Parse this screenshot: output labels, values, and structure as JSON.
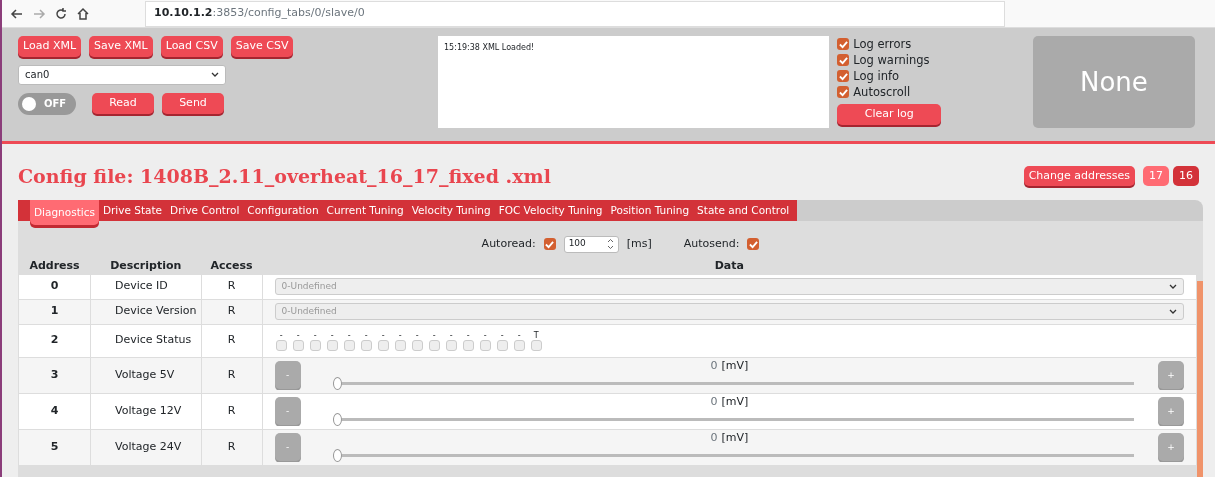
{
  "browser": {
    "url_host": "10.10.1.2",
    "url_path": ":3853/config_tabs/0/slave/0"
  },
  "toolbar": {
    "file_buttons": [
      "Load XML",
      "Save XML",
      "Load CSV",
      "Save CSV"
    ],
    "interface": {
      "value": "can0"
    },
    "connection_toggle": {
      "label": "OFF",
      "on": false
    },
    "action_buttons": [
      "Read",
      "Send"
    ],
    "log_text": "15:19:38 XML Loaded!",
    "log_options": [
      {
        "label": "Log errors",
        "checked": true
      },
      {
        "label": "Log warnings",
        "checked": true
      },
      {
        "label": "Log info",
        "checked": true
      },
      {
        "label": "Autoscroll",
        "checked": true
      }
    ],
    "clear_log": "Clear log",
    "status": "None"
  },
  "config_title": "Config file: 1408B_2.11_overheat_16_17_fixed .xml",
  "change_addresses": "Change addresses",
  "addresses": [
    {
      "label": "17",
      "selected": false
    },
    {
      "label": "16",
      "selected": true
    }
  ],
  "tabs": [
    {
      "label": "Diagnostics",
      "selected": true
    },
    {
      "label": "Drive State",
      "selected": false
    },
    {
      "label": "Drive Control",
      "selected": false
    },
    {
      "label": "Configuration",
      "selected": false
    },
    {
      "label": "Current Tuning",
      "selected": false
    },
    {
      "label": "Velocity Tuning",
      "selected": false
    },
    {
      "label": "FOC Velocity Tuning",
      "selected": false
    },
    {
      "label": "Position Tuning",
      "selected": false
    },
    {
      "label": "State and Control",
      "selected": false
    }
  ],
  "autoread": {
    "label": "Autoread:",
    "checked": true,
    "interval": "100",
    "unit": "[ms]"
  },
  "autosend": {
    "label": "Autosend:",
    "checked": true
  },
  "table": {
    "columns": [
      "Address",
      "Description",
      "Access",
      "Data"
    ],
    "rows": [
      {
        "address": "0",
        "description": "Device ID",
        "access": "R",
        "kind": "select",
        "value": "0-Undefined"
      },
      {
        "address": "1",
        "description": "Device Version",
        "access": "R",
        "kind": "select",
        "value": "0-Undefined"
      },
      {
        "address": "2",
        "description": "Device Status",
        "access": "R",
        "kind": "bits",
        "bits": [
          {
            "label": "-",
            "checked": false
          },
          {
            "label": "-",
            "checked": false
          },
          {
            "label": "-",
            "checked": false
          },
          {
            "label": "-",
            "checked": false
          },
          {
            "label": "-",
            "checked": false
          },
          {
            "label": "-",
            "checked": false
          },
          {
            "label": "-",
            "checked": false
          },
          {
            "label": "-",
            "checked": false
          },
          {
            "label": "-",
            "checked": false
          },
          {
            "label": "-",
            "checked": false
          },
          {
            "label": "-",
            "checked": false
          },
          {
            "label": "-",
            "checked": false
          },
          {
            "label": "-",
            "checked": false
          },
          {
            "label": "-",
            "checked": false
          },
          {
            "label": "-",
            "checked": false
          },
          {
            "label": "T",
            "checked": false
          }
        ]
      },
      {
        "address": "3",
        "description": "Voltage 5V",
        "access": "R",
        "kind": "slider",
        "minus": "-",
        "plus": "+",
        "value": "0",
        "unit": "[mV]",
        "level": 0
      },
      {
        "address": "4",
        "description": "Voltage 12V",
        "access": "R",
        "kind": "slider",
        "minus": "-",
        "plus": "+",
        "value": "0",
        "unit": "[mV]",
        "level": 0
      },
      {
        "address": "5",
        "description": "Voltage 24V",
        "access": "R",
        "kind": "slider",
        "minus": "-",
        "plus": "+",
        "value": "0",
        "unit": "[mV]",
        "level": 0
      }
    ]
  }
}
